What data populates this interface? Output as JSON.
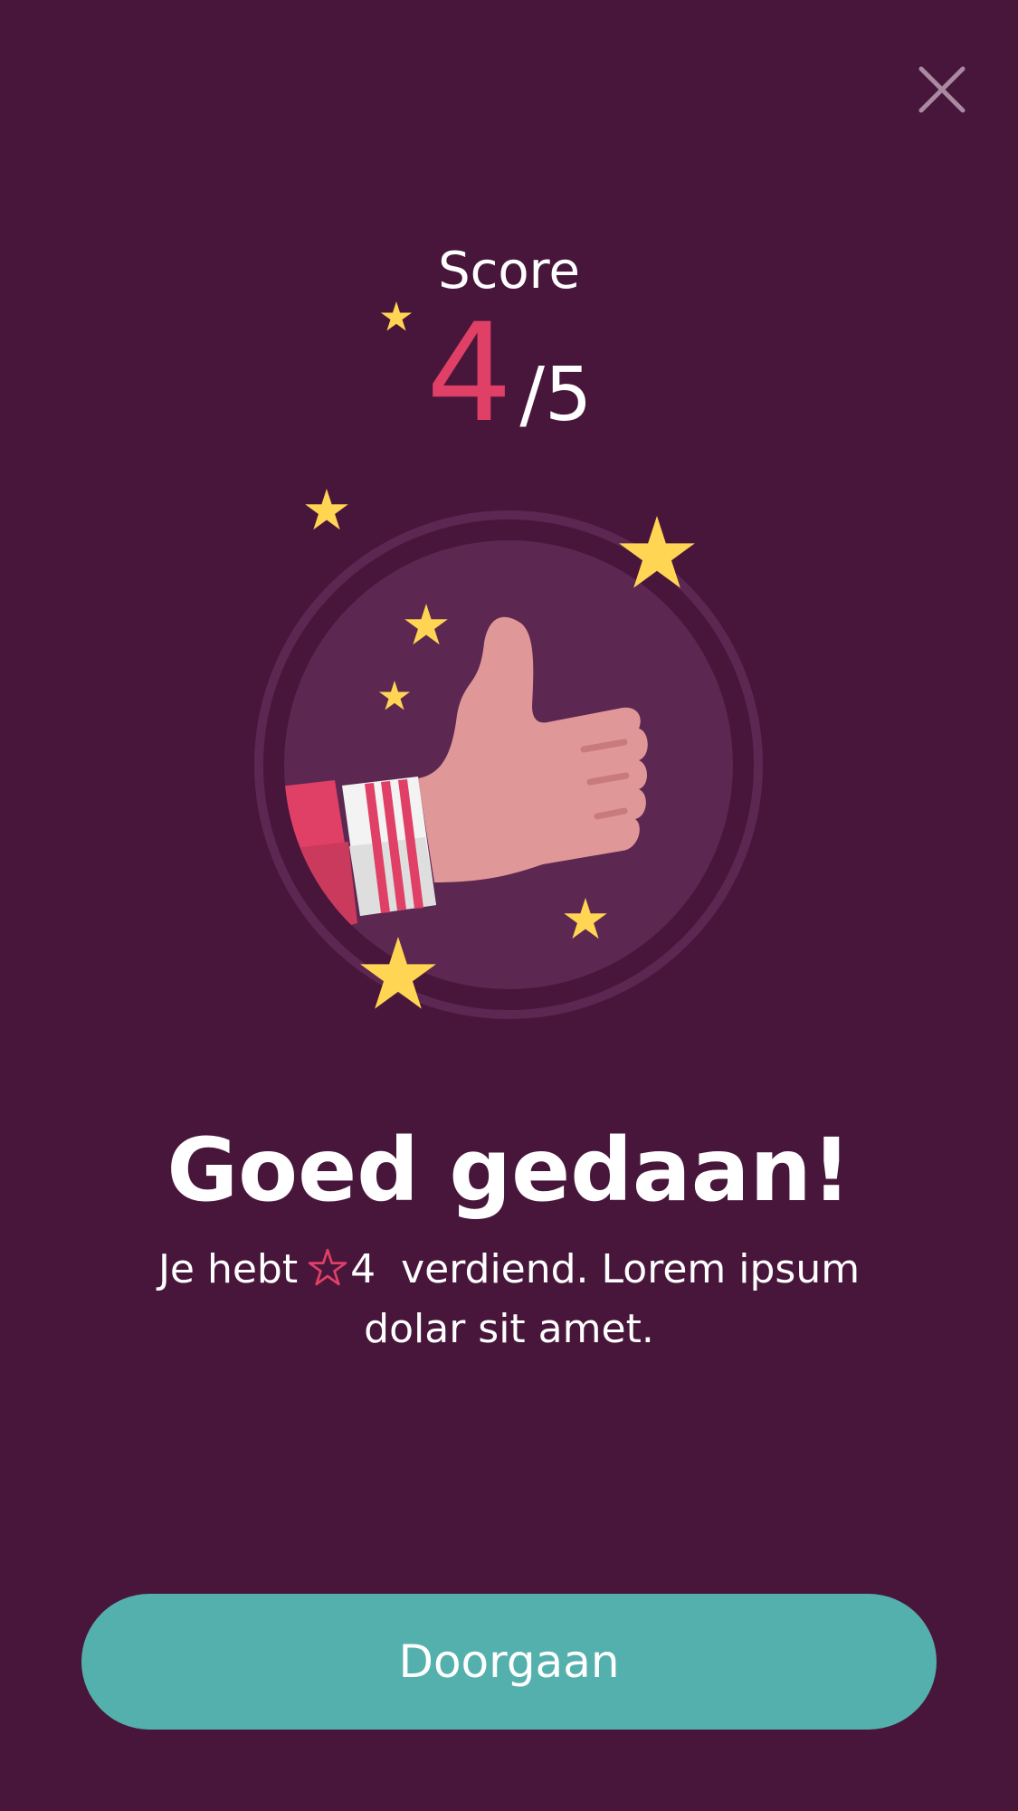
{
  "dialog": {
    "close_icon": "close-icon",
    "close_color": "#a98aa0"
  },
  "score": {
    "label": "Score",
    "value": "4",
    "total": "/5"
  },
  "illustration": {
    "icon": "thumbs-up-icon",
    "star_color": "#ffd553",
    "circle_color": "#5c2751"
  },
  "result": {
    "headline": "Goed gedaan!",
    "text_before": "Je hebt",
    "reward_icon": "star-outline-icon",
    "reward_count": "4",
    "text_after": "verdiend. Lorem ipsum dolar sit amet."
  },
  "actions": {
    "continue_label": "Doorgaan"
  },
  "colors": {
    "background": "#48163b",
    "accent": "#e03f66",
    "button": "#54b0ad"
  }
}
